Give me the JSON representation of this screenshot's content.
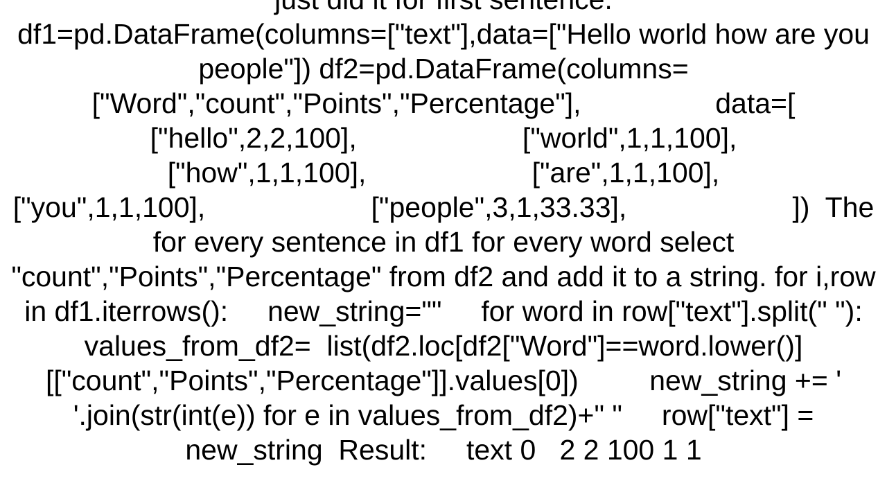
{
  "document": {
    "body": "just did it for first sentence.\ndf1=pd.DataFrame(columns=[\"text\"],data=[\"Hello world how are you people\"]) df2=pd.DataFrame(columns=[\"Word\",\"count\",\"Points\",\"Percentage\"],                 data=[                     [\"hello\",2,2,100],                     [\"world\",1,1,100],                     [\"how\",1,1,100],                     [\"are\",1,1,100],                     [\"you\",1,1,100],                     [\"people\",3,1,33.33],                     ])  The for every sentence in df1 for every word select \"count\",\"Points\",\"Percentage\" from df2 and add it to a string. for i,row in df1.iterrows():     new_string=\"\"     for word in row[\"text\"].split(\" \"):         values_from_df2=  list(df2.loc[df2[\"Word\"]==word.lower()][[\"count\",\"Points\",\"Percentage\"]].values[0])         new_string += ' '.join(str(int(e)) for e in values_from_df2)+\" \"     row[\"text\"] = new_string  Result:     text 0   2 2 100 1 1"
  }
}
